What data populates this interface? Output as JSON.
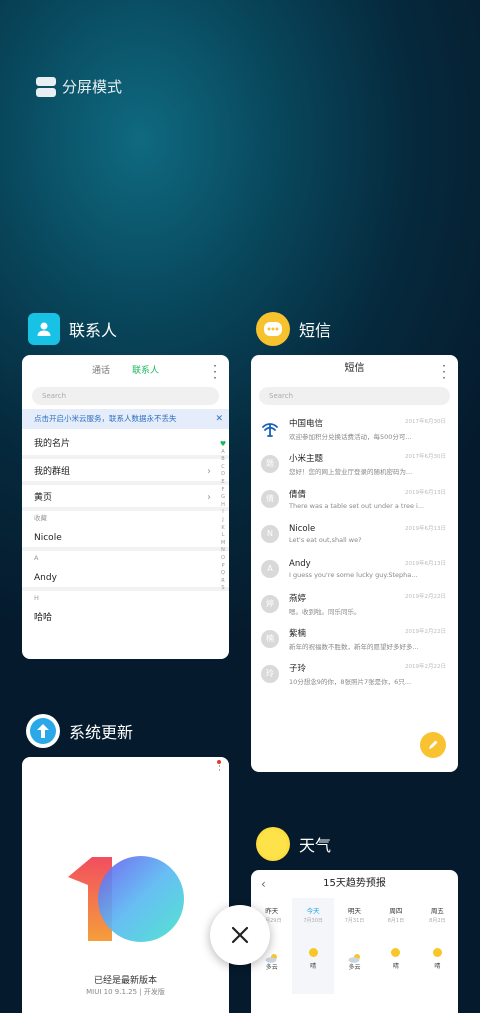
{
  "split_screen": {
    "label": "分屏模式"
  },
  "apps": {
    "contacts": {
      "name": "联系人",
      "tabs": [
        "通话",
        "联系人"
      ],
      "search_placeholder": "Search",
      "banner": "点击开启小米云服务，联系人数据永不丢失",
      "rows": {
        "my_card": "我的名片",
        "my_groups": "我的群组",
        "yellow_pages": "黄页"
      },
      "sections": {
        "favorites": "收藏",
        "a": "A",
        "h": "H"
      },
      "contacts": {
        "nicole": "Nicole",
        "andy": "Andy",
        "haha": "哈哈"
      },
      "alphabet": [
        "A",
        "B",
        "C",
        "D",
        "E",
        "F",
        "G",
        "H",
        "I",
        "J",
        "K",
        "L",
        "M",
        "N",
        "O",
        "P",
        "Q",
        "R",
        "S"
      ]
    },
    "messages": {
      "name": "短信",
      "title": "短信",
      "search_placeholder": "Search",
      "threads": [
        {
          "name": "中国电信",
          "time": "2017年6月30日",
          "preview": "欢迎参加积分兑换话费活动，每500分可...",
          "avatar": ""
        },
        {
          "name": "小米主题",
          "time": "2017年6月30日",
          "preview": "您好！您的网上营业厅登录的随机密码为...",
          "avatar": "题"
        },
        {
          "name": "倩倩",
          "time": "2019年6月13日",
          "preview": "There was a table set out under a tree i...",
          "avatar": "倩"
        },
        {
          "name": "Nicole",
          "time": "2019年6月13日",
          "preview": "Let's eat out,shall we?",
          "avatar": "N"
        },
        {
          "name": "Andy",
          "time": "2019年6月13日",
          "preview": "I guess you're some lucky guy.Stepha...",
          "avatar": "A"
        },
        {
          "name": "燕婷",
          "time": "2019年2月22日",
          "preview": "嗯。收到啦。同乐同乐。",
          "avatar": "婷"
        },
        {
          "name": "紫楠",
          "time": "2019年2月22日",
          "preview": "新年的祝福数不胜数，新年的愿望好多好多...",
          "avatar": "楠"
        },
        {
          "name": "子玲",
          "time": "2019年2月22日",
          "preview": "10分想念9的你，8张照片7张是你，6只...",
          "avatar": "玲"
        }
      ]
    },
    "updater": {
      "name": "系统更新",
      "latest": "已经是最新版本",
      "version": "MIUI 10 9.1.25 | 开发版"
    },
    "weather": {
      "name": "天气",
      "title": "15天趋势预报",
      "days": [
        {
          "label": "昨天",
          "date": "7月29日",
          "cond": "多云",
          "icon": "partly-cloudy"
        },
        {
          "label": "今天",
          "date": "7月30日",
          "cond": "晴",
          "icon": "sun"
        },
        {
          "label": "明天",
          "date": "7月31日",
          "cond": "多云",
          "icon": "partly-cloudy"
        },
        {
          "label": "周四",
          "date": "8月1日",
          "cond": "晴",
          "icon": "sun"
        },
        {
          "label": "周五",
          "date": "8月2日",
          "cond": "晴",
          "icon": "sun"
        }
      ]
    }
  },
  "close_button": {
    "icon": "close-icon"
  }
}
